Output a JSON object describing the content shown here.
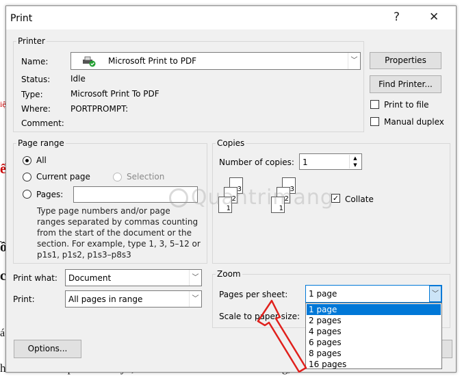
{
  "background_doc": {
    "bottom_line": "hăm “Dế mèn phiêu lưu ký”, nhà văn Tô Hoài đã rất nổi tiếng, đã làm đ",
    "left_fragments": [
      "iệ",
      "ế",
      "ồ",
      "c",
      "á"
    ]
  },
  "dialog": {
    "title": "Print",
    "help_label": "?",
    "close_label": "✕"
  },
  "printer": {
    "legend": "Printer",
    "name_label": "Name:",
    "name_value": "Microsoft Print to PDF",
    "status_label": "Status:",
    "status_value": "Idle",
    "type_label": "Type:",
    "type_value": "Microsoft Print To PDF",
    "where_label": "Where:",
    "where_value": "PORTPROMPT:",
    "comment_label": "Comment:",
    "properties_label": "Properties",
    "find_printer_label": "Find Printer...",
    "print_to_file_label": "Print to file",
    "manual_duplex_label": "Manual duplex"
  },
  "page_range": {
    "legend": "Page range",
    "all_label": "All",
    "current_page_label": "Current page",
    "selection_label": "Selection",
    "pages_label": "Pages:",
    "pages_value": "",
    "help_lines": [
      "Type page numbers and/or page",
      "ranges separated by commas counting",
      "from the start of the document or the",
      "section. For example, type 1, 3, 5–12 or",
      "p1s1, p1s2, p1s3–p8s3"
    ]
  },
  "copies": {
    "legend": "Copies",
    "number_label": "Number of copies:",
    "number_value": "1",
    "collate_label": "Collate",
    "sheet_numbers": [
      "1",
      "2",
      "3"
    ]
  },
  "print_what": {
    "label": "Print what:",
    "value": "Document"
  },
  "print_range": {
    "label": "Print:",
    "value": "All pages in range"
  },
  "zoom": {
    "legend": "Zoom",
    "pages_per_sheet_label": "Pages per sheet:",
    "pages_per_sheet_value": "1 page",
    "scale_label": "Scale to paper size:",
    "options": [
      "1 page",
      "2 pages",
      "4 pages",
      "6 pages",
      "8 pages",
      "16 pages"
    ]
  },
  "footer": {
    "options_label": "Options..."
  },
  "watermark": {
    "text": "Quantrimang"
  },
  "colors": {
    "dialog_bg": "#f0f0f0",
    "selection": "#0078d7",
    "arrow": "#e0201c"
  },
  "icons": [
    "printer-icon",
    "chevron-down-icon",
    "close-icon",
    "help-icon",
    "spin-up-icon",
    "spin-down-icon",
    "check-icon",
    "arrow-annotation-icon"
  ]
}
